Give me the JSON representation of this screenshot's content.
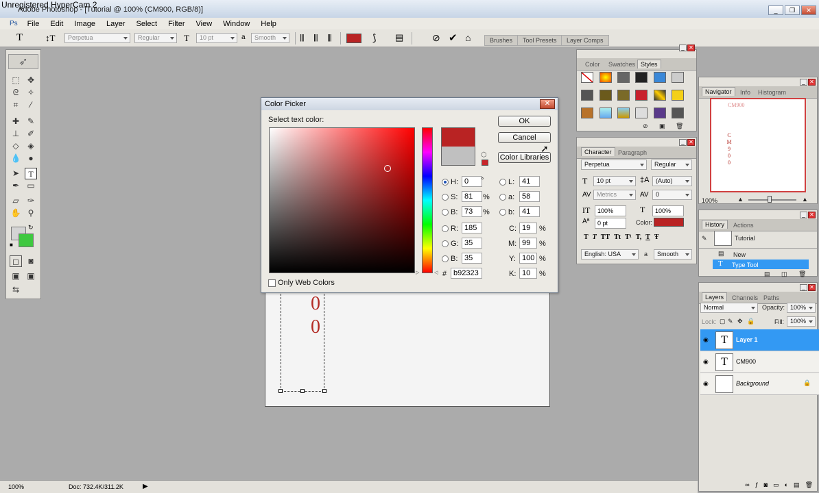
{
  "watermark": "Unregistered HyperCam 2",
  "window": {
    "title": "Adobe Photoshop - [Tutorial @ 100% (CM900, RGB/8)]"
  },
  "menu": [
    "File",
    "Edit",
    "Image",
    "Layer",
    "Select",
    "Filter",
    "View",
    "Window",
    "Help"
  ],
  "options": {
    "font_family": "Perpetua",
    "font_style": "Regular",
    "font_size": "10 pt",
    "antialias": "Smooth",
    "color": "#b92323",
    "well_tabs": [
      "Brushes",
      "Tool Presets",
      "Layer Comps"
    ]
  },
  "document": {
    "glyphs": [
      "0",
      "0"
    ]
  },
  "status": {
    "zoom": "100%",
    "doc": "Doc: 732.4K/311.2K"
  },
  "color_picker": {
    "title": "Color Picker",
    "prompt": "Select text color:",
    "ok": "OK",
    "cancel": "Cancel",
    "libraries": "Color Libraries",
    "new_color": "#b92323",
    "current_color": "#c0c0c0",
    "hsb": {
      "h": "0",
      "h_unit": "°",
      "s": "81",
      "s_unit": "%",
      "b": "73",
      "b_unit": "%"
    },
    "rgb": {
      "r": "185",
      "g": "35",
      "b": "35"
    },
    "lab": {
      "l": "41",
      "a": "58",
      "b": "41"
    },
    "cmyk": {
      "c": "19",
      "c_unit": "%",
      "m": "99",
      "m_unit": "%",
      "y": "100",
      "y_unit": "%",
      "k": "10",
      "k_unit": "%"
    },
    "hex": "b92323",
    "hex_prefix": "#",
    "only_web": "Only Web Colors",
    "labels": {
      "h": "H:",
      "s": "S:",
      "b": "B:",
      "r": "R:",
      "g": "G:",
      "bb": "B:",
      "l": "L:",
      "a": "a:",
      "lb": "b:",
      "c": "C:",
      "m": "M:",
      "y": "Y:",
      "k": "K:"
    }
  },
  "color_panel": {
    "tabs": [
      "Color",
      "Swatches",
      "Styles"
    ]
  },
  "character_panel": {
    "tabs": [
      "Character",
      "Paragraph"
    ],
    "font": "Perpetua",
    "style": "Regular",
    "size": "10 pt",
    "leading": "(Auto)",
    "kerning": "Metrics",
    "tracking": "0",
    "vscale": "100%",
    "hscale": "100%",
    "baseline": "0 pt",
    "color_label": "Color:",
    "color": "#b92323",
    "language": "English: USA",
    "aa": "Smooth",
    "glyph_buttons": [
      "T",
      "T",
      "TT",
      "Tt",
      "T¹",
      "T,",
      "T",
      "Ŧ"
    ]
  },
  "navigator": {
    "tabs": [
      "Navigator",
      "Info",
      "Histogram"
    ],
    "zoom": "100%",
    "preview_title": "CM900",
    "preview_letters": [
      "C",
      "M",
      "9",
      "0",
      "0"
    ]
  },
  "history": {
    "tabs": [
      "History",
      "Actions"
    ],
    "snapshot": "Tutorial",
    "items": [
      "New",
      "Type Tool"
    ]
  },
  "layers": {
    "tabs": [
      "Layers",
      "Channels",
      "Paths"
    ],
    "blend": "Normal",
    "opacity_label": "Opacity:",
    "opacity": "100%",
    "lock_label": "Lock:",
    "fill_label": "Fill:",
    "fill": "100%",
    "rows": [
      {
        "name": "Layer 1",
        "thumb": "T"
      },
      {
        "name": "CM900",
        "thumb": "T"
      },
      {
        "name": "Background",
        "thumb": ""
      }
    ]
  }
}
